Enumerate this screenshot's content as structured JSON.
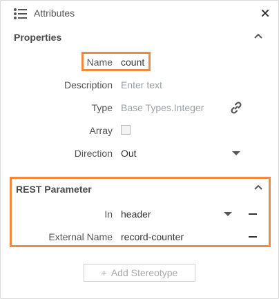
{
  "window": {
    "title": "Attributes"
  },
  "properties": {
    "section_title": "Properties",
    "rows": {
      "name": {
        "label": "Name",
        "value": "count"
      },
      "description": {
        "label": "Description",
        "placeholder": "Enter text"
      },
      "type": {
        "label": "Type",
        "value": "Base Types.Integer"
      },
      "array": {
        "label": "Array",
        "checked": false
      },
      "direction": {
        "label": "Direction",
        "value": "Out"
      }
    }
  },
  "rest_parameter": {
    "section_title": "REST Parameter",
    "rows": {
      "in": {
        "label": "In",
        "value": "header"
      },
      "external_name": {
        "label": "External Name",
        "value": "record-counter"
      }
    }
  },
  "actions": {
    "add_stereotype": "Add Stereotype",
    "add_stereotype_symbol": "+"
  },
  "icons": {
    "header": "list-icon",
    "close": "close-icon",
    "collapse": "chevron-up-icon",
    "type_link": "link-icon",
    "dropdown": "caret-down-icon",
    "remove": "minus-icon"
  },
  "colors": {
    "highlight": "#f08a42",
    "icon": "#555555"
  }
}
